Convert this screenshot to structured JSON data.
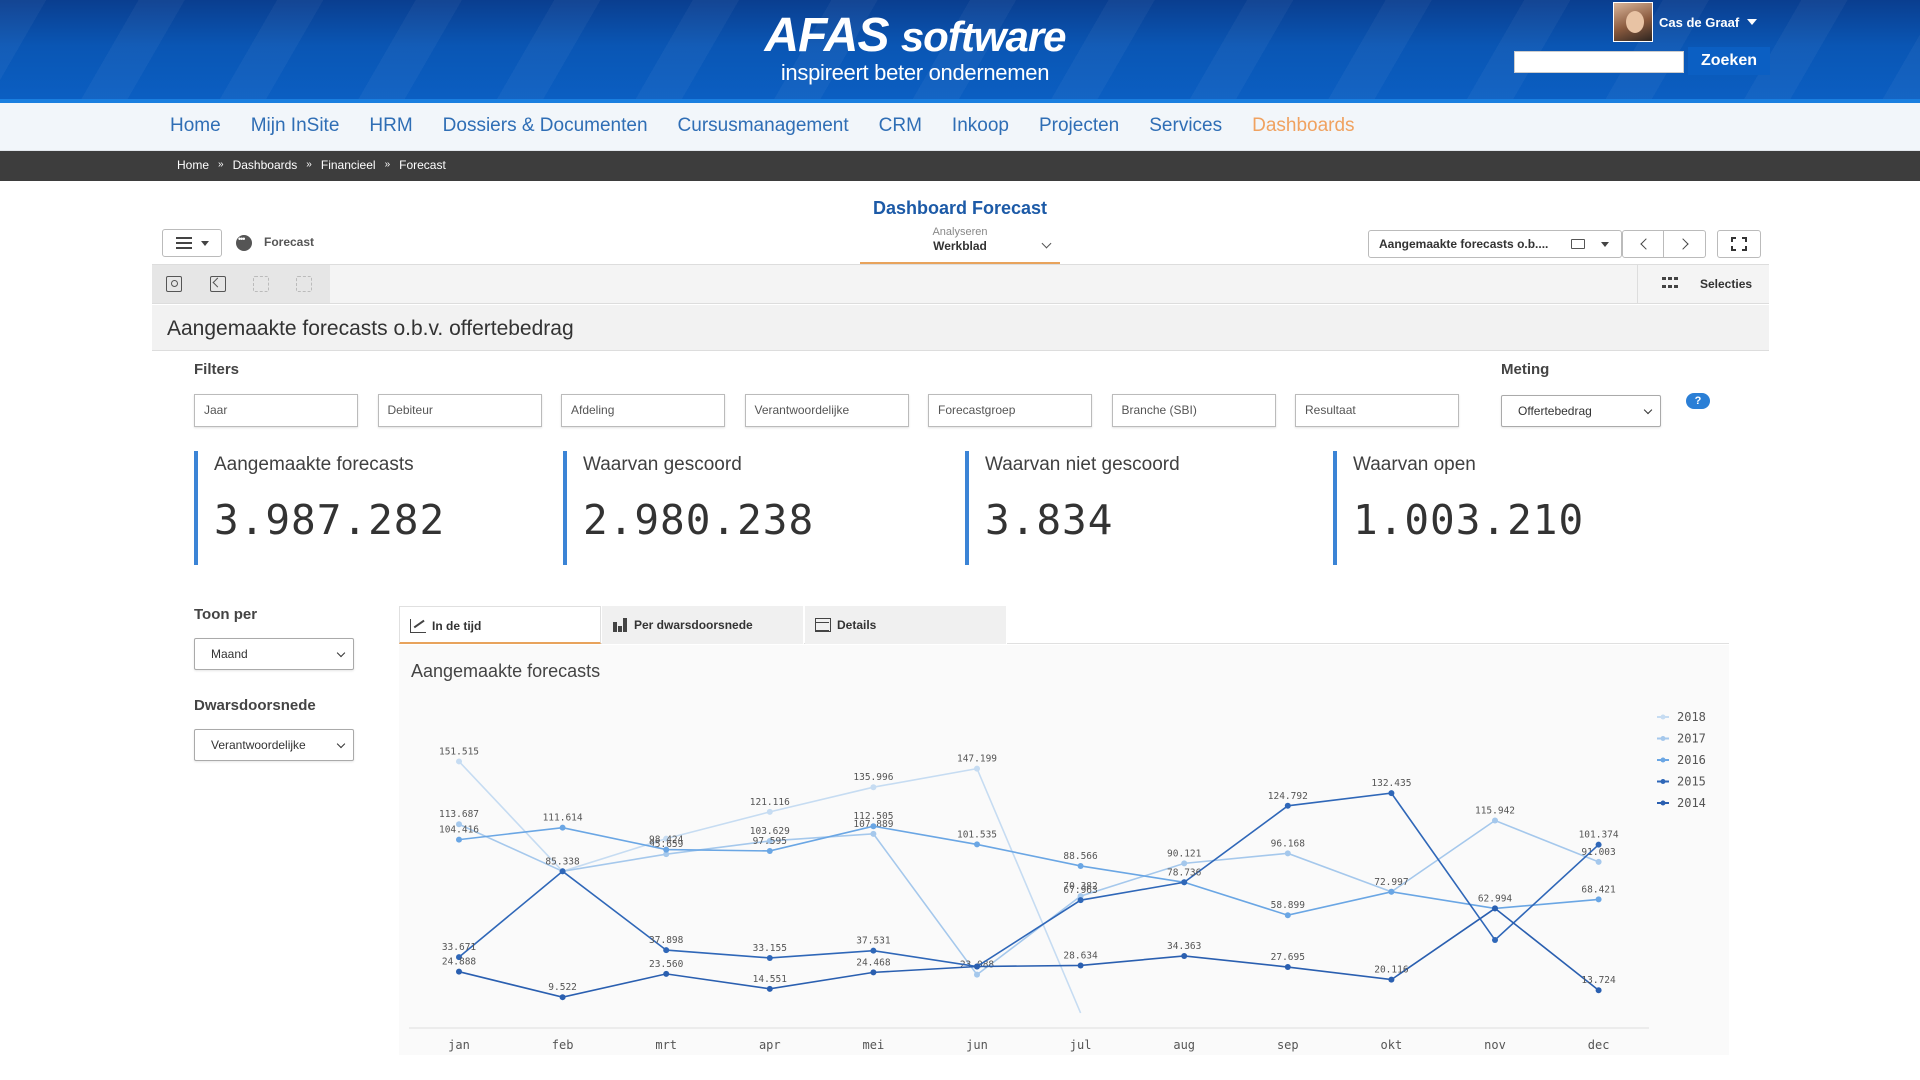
{
  "brand": {
    "logo_main": "AFAS software",
    "logo_main_a": "AFAS",
    "logo_main_b": "software",
    "tagline": "inspireert beter ondernemen"
  },
  "user": {
    "name": "Cas de Graaf"
  },
  "search": {
    "placeholder": "",
    "button_label": "Zoeken"
  },
  "mainnav": {
    "items": [
      "Home",
      "Mijn InSite",
      "HRM",
      "Dossiers & Documenten",
      "Cursusmanagement",
      "CRM",
      "Inkoop",
      "Projecten",
      "Services",
      "Dashboards"
    ],
    "active": "Dashboards"
  },
  "breadcrumb": [
    "Home",
    "Dashboards",
    "Financieel",
    "Forecast"
  ],
  "dashboard": {
    "title": "Dashboard Forecast",
    "app_name": "Forecast",
    "mode_label": "Analyseren",
    "mode_value": "Werkblad",
    "sheet_selector": "Aangemaakte forecasts o.b....",
    "selections_label": "Selecties",
    "sheet_title": "Aangemaakte forecasts o.b.v. offertebedrag"
  },
  "filters": {
    "label": "Filters",
    "items": [
      "Jaar",
      "Debiteur",
      "Afdeling",
      "Verantwoordelijke",
      "Forecastgroep",
      "Branche (SBI)",
      "Resultaat"
    ],
    "meting_label": "Meting",
    "meting_value": "Offertebedrag"
  },
  "kpis": [
    {
      "title": "Aangemaakte forecasts",
      "value": "3.987.282"
    },
    {
      "title": "Waarvan gescoord",
      "value": "2.980.238"
    },
    {
      "title": "Waarvan niet gescoord",
      "value": "3.834"
    },
    {
      "title": "Waarvan open",
      "value": "1.003.210"
    }
  ],
  "controls": {
    "toon_per_label": "Toon per",
    "toon_per_value": "Maand",
    "dwars_label": "Dwarsdoorsnede",
    "dwars_value": "Verantwoordelijke"
  },
  "tabs": [
    "In de tijd",
    "Per dwarsdoorsnede",
    "Details"
  ],
  "active_tab": "In de tijd",
  "colors": {
    "accent_blue": "#1c5aa7",
    "kpi_border": "#3b84d6",
    "active_orange": "#e8a35c"
  },
  "chart_data": {
    "type": "line",
    "title": "Aangemaakte forecasts",
    "categories": [
      "jan",
      "feb",
      "mrt",
      "apr",
      "mei",
      "jun",
      "jul",
      "aug",
      "sep",
      "okt",
      "nov",
      "dec"
    ],
    "ylim": [
      0,
      160000
    ],
    "legend_position": "top-right",
    "series": [
      {
        "name": "2018",
        "color": "#c6dcf2",
        "values": [
          151515,
          85338,
          105018,
          121116,
          135996,
          147199,
          0,
          null,
          null,
          null,
          null,
          null
        ],
        "labels": [
          "151.515",
          "",
          "",
          "121.116",
          "135.996",
          "147.199",
          "",
          "",
          "",
          "",
          "",
          ""
        ]
      },
      {
        "name": "2017",
        "color": "#a5c8ec",
        "values": [
          113687,
          85338,
          95659,
          103629,
          107889,
          23088,
          70382,
          90121,
          96168,
          72997,
          115942,
          91003
        ],
        "labels": [
          "113.687",
          "85.338",
          "95.659",
          "103.629",
          "107.889",
          "23.088",
          "70.382",
          "90.121",
          "96.168",
          "72.997",
          "115.942",
          "91.003"
        ]
      },
      {
        "name": "2016",
        "color": "#6aa6e4",
        "values": [
          104416,
          111614,
          98424,
          97595,
          112505,
          101535,
          88566,
          78736,
          58899,
          72997,
          62994,
          68421
        ],
        "labels": [
          "104.416",
          "111.614",
          "98.424",
          "97.595",
          "112.505",
          "101.535",
          "88.566",
          "",
          "58.899",
          "",
          "62.994",
          "68.421"
        ]
      },
      {
        "name": "2015",
        "color": "#2f67b8",
        "values": [
          33671,
          85338,
          37898,
          33155,
          37531,
          28000,
          67963,
          78736,
          124792,
          132435,
          44000,
          101374
        ],
        "labels": [
          "33.671",
          "",
          "37.898",
          "33.155",
          "37.531",
          "",
          "67.963",
          "78.736",
          "124.792",
          "132.435",
          "",
          "101.374"
        ]
      },
      {
        "name": "2014",
        "color": "#2a5fb0",
        "values": [
          24888,
          9522,
          23560,
          14551,
          24468,
          28000,
          28634,
          34363,
          27695,
          20116,
          62994,
          13724
        ],
        "labels": [
          "24.888",
          "9.522",
          "23.560",
          "14.551",
          "24.468",
          "",
          "28.634",
          "34.363",
          "27.695",
          "20.116",
          "",
          "13.724"
        ]
      }
    ]
  }
}
